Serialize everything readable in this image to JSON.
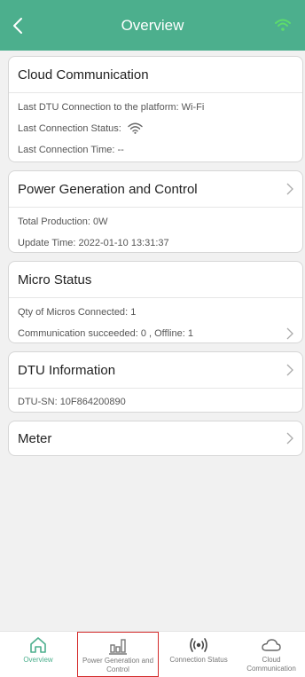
{
  "colors": {
    "accent": "#4caf8d",
    "highlight": "#d42a2a"
  },
  "header": {
    "title": "Overview",
    "back_icon": "chevron-left-icon",
    "status_icon": "wifi-icon"
  },
  "cloud": {
    "title": "Cloud Communication",
    "connection_label": "Last DTU Connection to the platform",
    "connection_value": "Wi-Fi",
    "status_label": "Last Connection Status",
    "time_label": "Last Connection Time",
    "time_value": "--"
  },
  "power": {
    "title": "Power Generation and Control",
    "production_label": "Total Production",
    "production_value": "0W",
    "update_label": "Update Time",
    "update_value": "2022-01-10 13:31:37"
  },
  "micro": {
    "title": "Micro Status",
    "qty_label": "Qty of Micros Connected",
    "qty_value": "1",
    "comm_label": "Communication succeeded",
    "comm_value": "0",
    "offline_label": "Offline",
    "offline_value": "1"
  },
  "dtu": {
    "title": "DTU Information",
    "sn_label": "DTU-SN",
    "sn_value": "10F864200890"
  },
  "meter": {
    "title": "Meter"
  },
  "tabs": [
    {
      "label": "Overview",
      "icon": "home-icon",
      "active": true
    },
    {
      "label": "Power Generation and Control",
      "icon": "bar-chart-icon",
      "active": false
    },
    {
      "label": "Connection Status",
      "icon": "broadcast-icon",
      "active": false
    },
    {
      "label": "Cloud Communication",
      "icon": "cloud-icon",
      "active": false
    }
  ]
}
